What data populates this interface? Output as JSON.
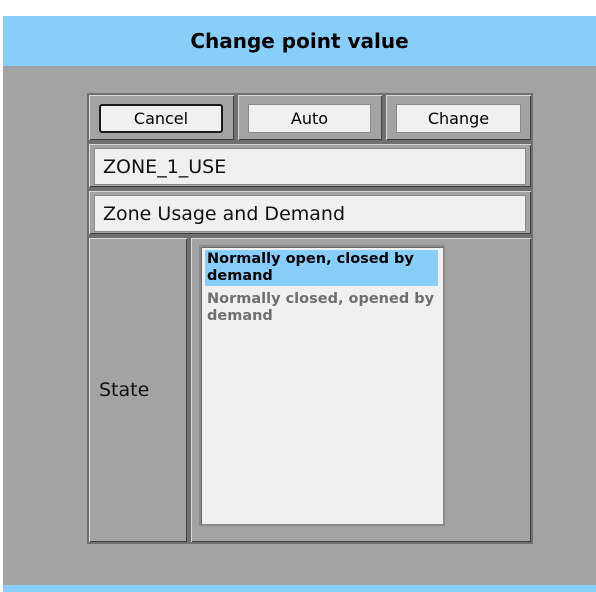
{
  "dialog": {
    "title": "Change point value"
  },
  "buttons": {
    "cancel": "Cancel",
    "auto": "Auto",
    "change": "Change"
  },
  "point": {
    "name": "ZONE_1_USE",
    "description": "Zone Usage and Demand"
  },
  "state": {
    "label": "State",
    "options": [
      {
        "label": "Normally open, closed by demand",
        "selected": true
      },
      {
        "label": "Normally closed, opened by demand",
        "selected": false
      }
    ]
  },
  "colors": {
    "titlebar": "#87cefa",
    "background": "#a3a3a3",
    "selection": "#87cefa"
  }
}
